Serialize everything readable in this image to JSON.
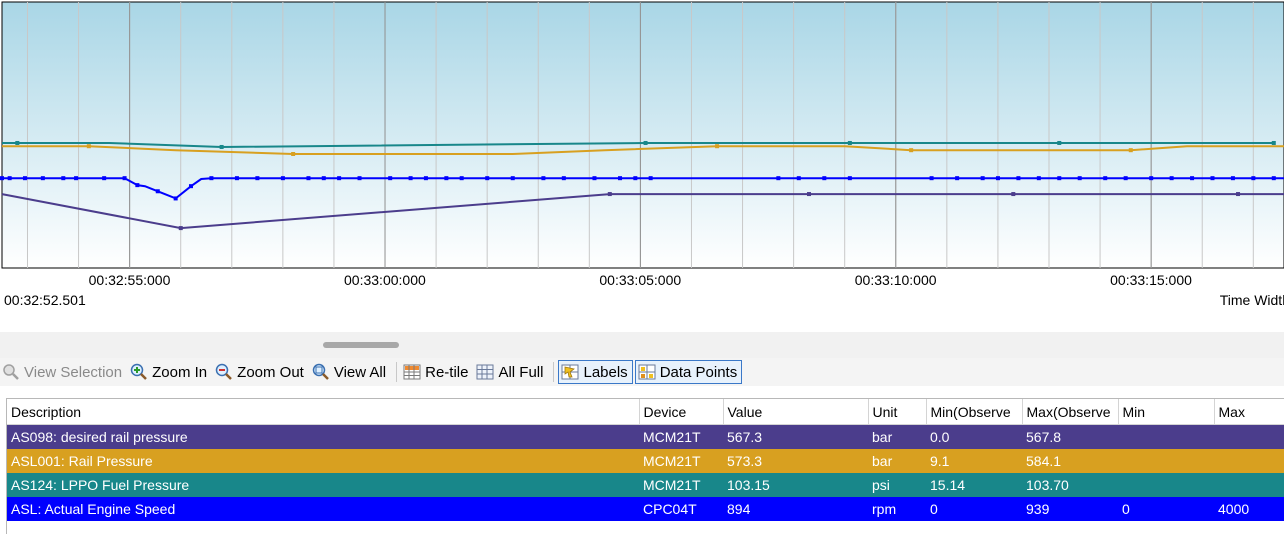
{
  "chart": {
    "start_time": "00:32:52.501",
    "time_width_label": "Time Width",
    "ticks": [
      {
        "label": "00:32:55:000",
        "t": 2.499
      },
      {
        "label": "00:33:00:000",
        "t": 7.499
      },
      {
        "label": "00:33:05:000",
        "t": 12.499
      },
      {
        "label": "00:33:10:000",
        "t": 17.499
      },
      {
        "label": "00:33:15:000",
        "t": 22.499
      }
    ]
  },
  "chart_data": {
    "type": "line",
    "x_unit": "seconds since 00:32:52.501",
    "xlim": [
      0,
      25.1
    ],
    "grid": true,
    "series": [
      {
        "name": "AS124: LPPO Fuel Pressure",
        "color": "#18878a",
        "ylim": [
          99,
          109
        ],
        "x": [
          0,
          0.3,
          2.1,
          4.3,
          12.6,
          16.6,
          20.7,
          24.9
        ],
        "y": [
          103.7,
          103.7,
          103.7,
          103.55,
          103.7,
          103.7,
          103.7,
          103.7
        ],
        "markers": [
          0.3,
          4.3,
          12.6,
          16.6,
          20.7,
          24.9
        ]
      },
      {
        "name": "ASL001: Rail Pressure",
        "color": "#d8a020",
        "ylim": [
          520,
          660
        ],
        "x": [
          0,
          1.7,
          3.4,
          5.7,
          8.1,
          10.0,
          11.8,
          14.0,
          16.5,
          17.8,
          20.0,
          22.1,
          23.2,
          25.1
        ],
        "y": [
          584.1,
          584.1,
          582,
          580,
          580,
          580,
          582,
          584.1,
          584.1,
          582,
          582,
          582,
          584.1,
          584.1
        ],
        "markers": [
          1.7,
          5.7,
          14.0,
          17.8,
          22.1
        ]
      },
      {
        "name": "AS098: desired rail pressure",
        "color": "#4b3d8c",
        "ylim": [
          540,
          640
        ],
        "x": [
          0,
          3.5,
          11.9,
          15.8,
          19.8,
          24.2,
          25.1
        ],
        "y": [
          567.8,
          555,
          567.8,
          567.8,
          567.8,
          567.8,
          567.8
        ],
        "markers": [
          3.5,
          11.9,
          15.8,
          19.8,
          24.2
        ]
      },
      {
        "name": "ASL: Actual Engine Speed",
        "color": "#0000ff",
        "ylim": [
          500,
          1800
        ],
        "x": [
          0,
          2.4,
          2.65,
          2.8,
          3.05,
          3.2,
          3.4,
          3.7,
          3.9,
          4.1,
          25.1
        ],
        "y": [
          939,
          939,
          905,
          900,
          875,
          860,
          840,
          900,
          935,
          939,
          939
        ],
        "markers": [
          0,
          0.15,
          0.45,
          0.8,
          1.2,
          1.45,
          2.0,
          2.4,
          2.65,
          3.05,
          3.4,
          3.7,
          4.1,
          4.6,
          5.0,
          5.5,
          6.0,
          6.3,
          6.6,
          7.0,
          7.6,
          8.0,
          8.3,
          8.7,
          9.0,
          9.5,
          10.0,
          10.6,
          11.0,
          11.6,
          12.1,
          12.4,
          12.7,
          15.2,
          15.6,
          16.1,
          16.6,
          18.2,
          18.7,
          19.2,
          19.5,
          19.9,
          20.3,
          20.7,
          21.1,
          21.6,
          22.0,
          22.5,
          22.9,
          23.3,
          23.7,
          24.1,
          24.5,
          24.9
        ]
      }
    ]
  },
  "toolbar": {
    "view_selection": "View Selection",
    "zoom_in": "Zoom In",
    "zoom_out": "Zoom Out",
    "view_all": "View All",
    "retile": "Re-tile",
    "all_full": "All Full",
    "labels": "Labels",
    "data_points": "Data Points"
  },
  "table": {
    "headers": {
      "description": "Description",
      "device": "Device",
      "value": "Value",
      "unit": "Unit",
      "min_observed": "Min(Observe",
      "max_observed": "Max(Observe",
      "min": "Min",
      "max": "Max"
    },
    "rows": [
      {
        "description": "AS098: desired rail pressure",
        "device": "MCM21T",
        "value": "567.3",
        "unit": "bar",
        "min_observed": "0.0",
        "max_observed": "567.8",
        "min": "",
        "max": "",
        "color": "#4b3d8c"
      },
      {
        "description": "ASL001: Rail Pressure",
        "device": "MCM21T",
        "value": "573.3",
        "unit": "bar",
        "min_observed": "9.1",
        "max_observed": "584.1",
        "min": "",
        "max": "",
        "color": "#d8a020"
      },
      {
        "description": "AS124: LPPO Fuel Pressure",
        "device": "MCM21T",
        "value": "103.15",
        "unit": "psi",
        "min_observed": "15.14",
        "max_observed": "103.70",
        "min": "",
        "max": "",
        "color": "#18878a"
      },
      {
        "description": "ASL: Actual Engine Speed",
        "device": "CPC04T",
        "value": "894",
        "unit": "rpm",
        "min_observed": "0",
        "max_observed": "939",
        "min": "0",
        "max": "4000",
        "color": "#0000ff"
      }
    ]
  }
}
